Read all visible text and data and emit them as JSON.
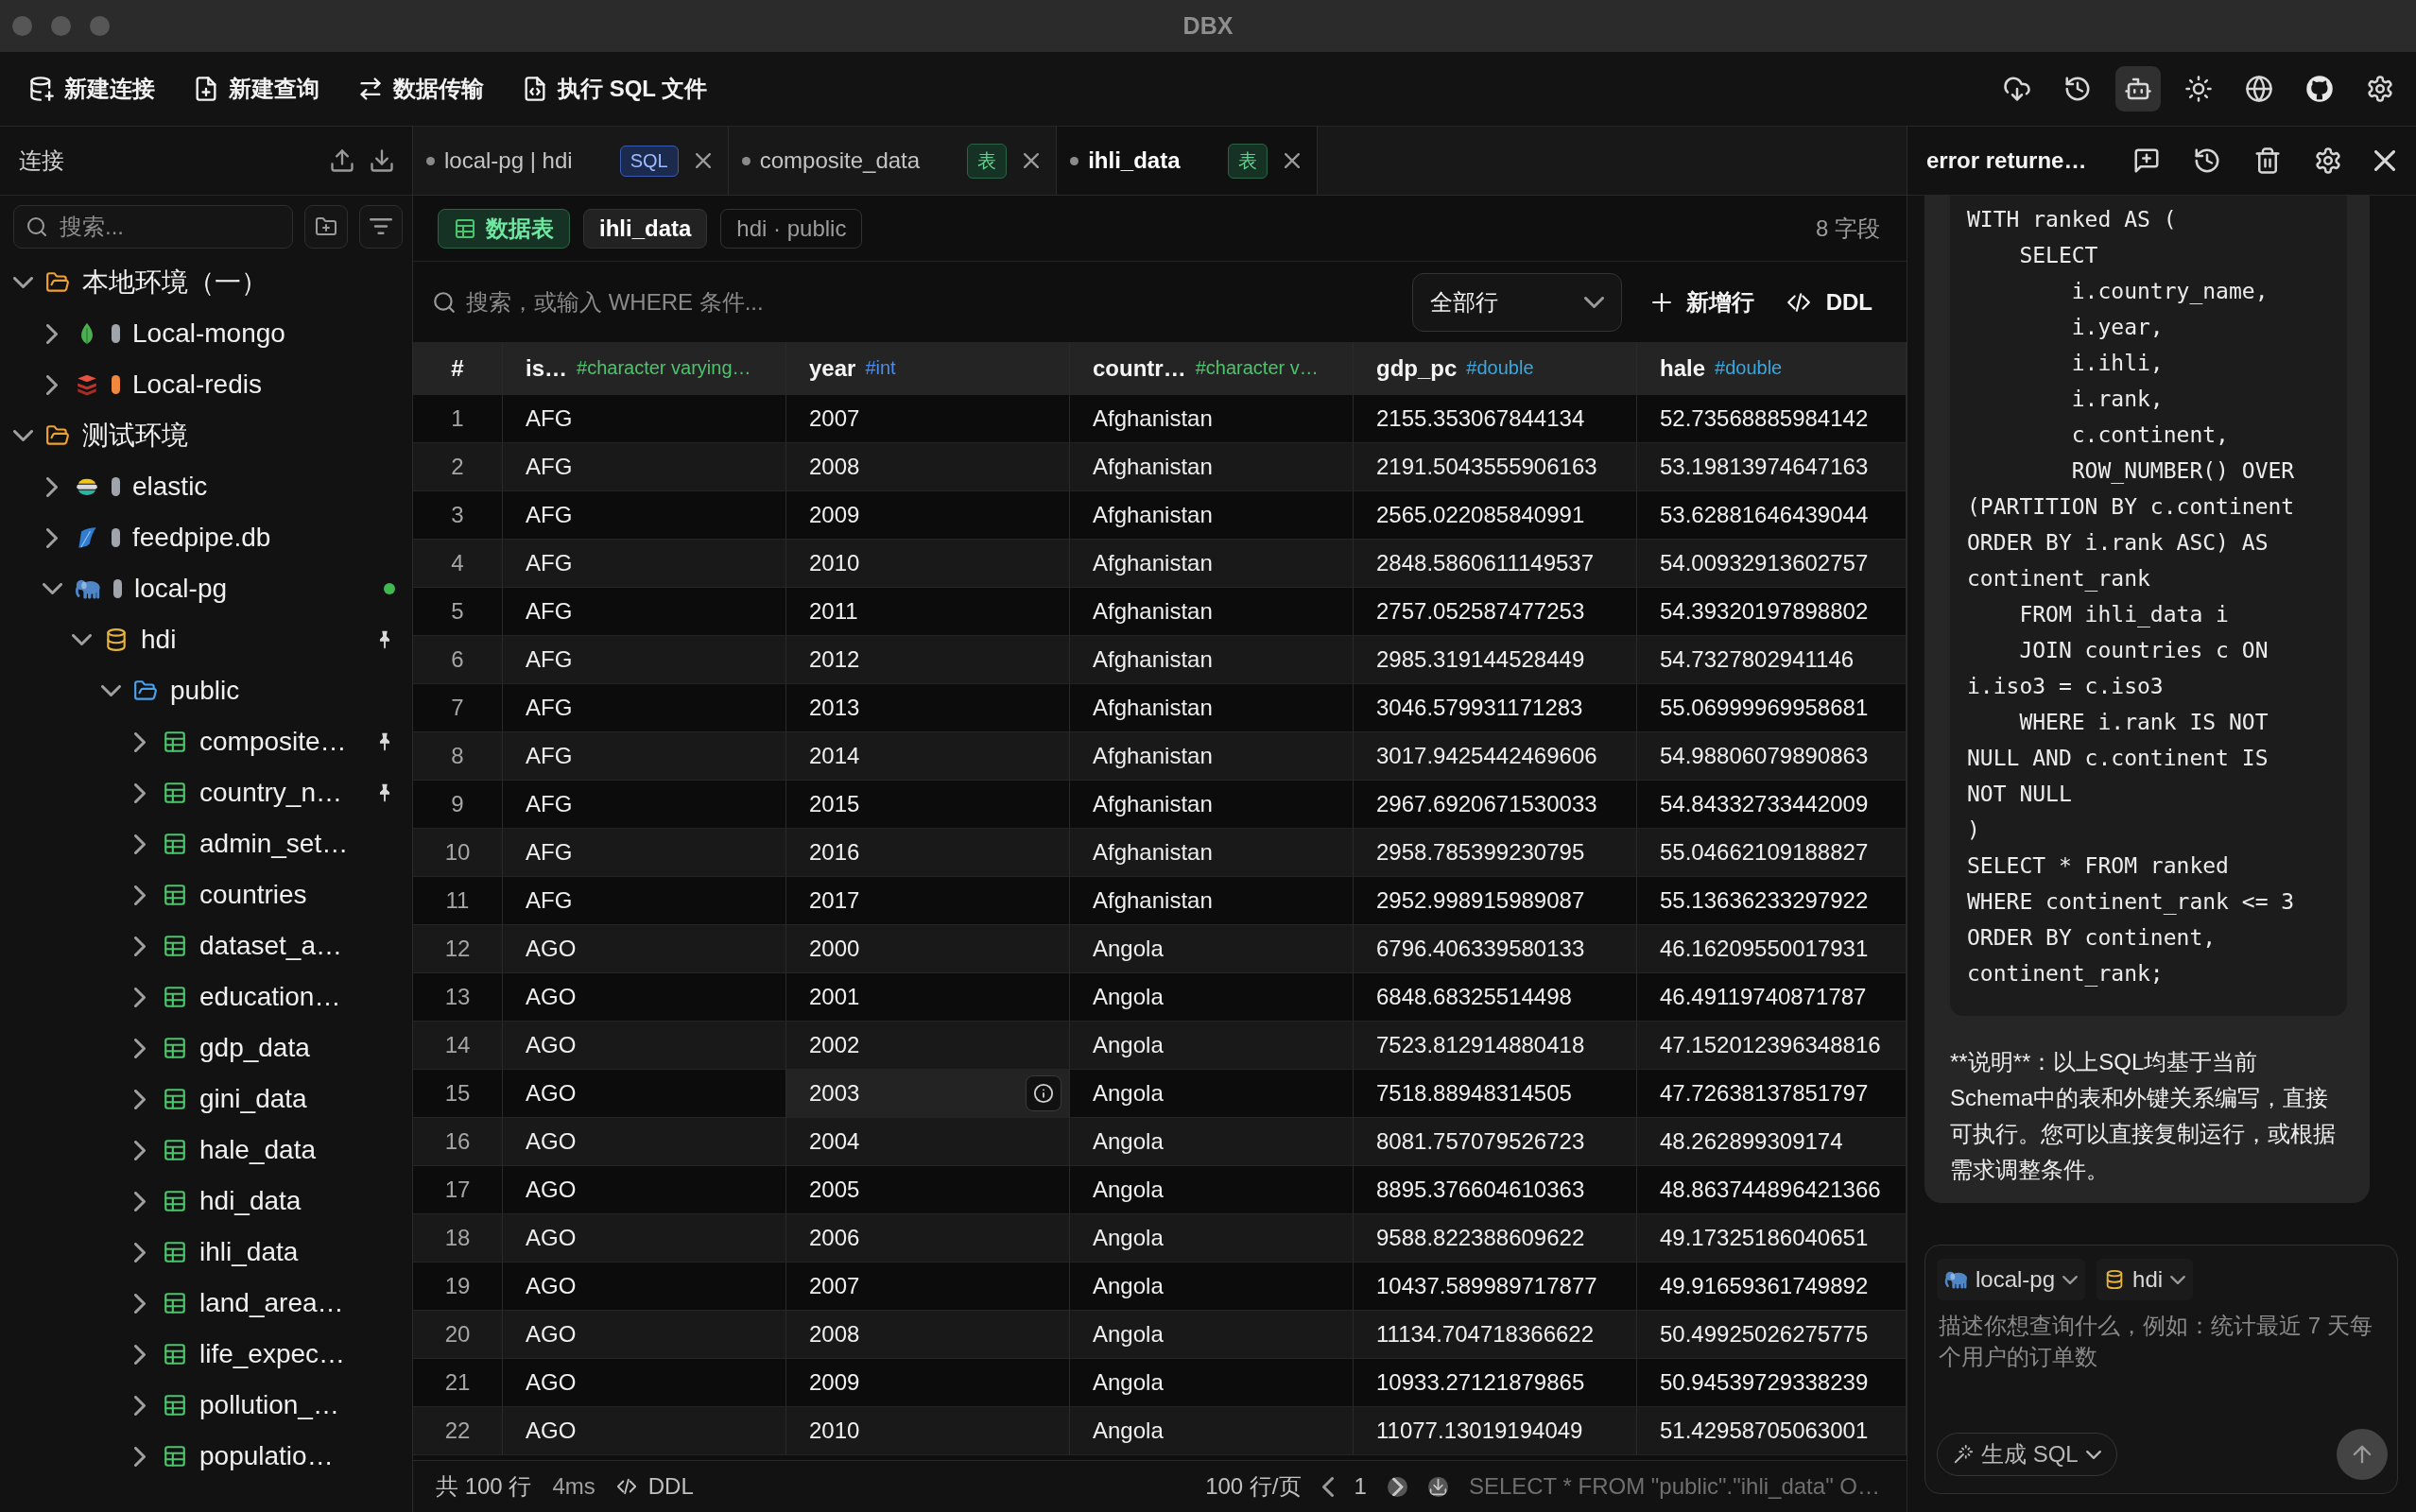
{
  "window": {
    "title": "DBX"
  },
  "toolbar": [
    {
      "label": "新建连接"
    },
    {
      "label": "新建查询"
    },
    {
      "label": "数据传输"
    },
    {
      "label": "执行 SQL 文件"
    }
  ],
  "toolbar_right": [
    {
      "selected": false
    },
    {
      "selected": false
    },
    {
      "selected": true
    },
    {
      "selected": false
    },
    {
      "selected": false
    },
    {
      "selected": false
    },
    {
      "selected": false
    }
  ],
  "sidebar": {
    "title": "连接",
    "search": {
      "placeholder": "搜索..."
    },
    "tree": [
      {
        "kind": "group",
        "label": "本地环境（一）",
        "expanded": true,
        "children": [
          {
            "kind": "mongodb",
            "label": "Local-mongo",
            "color": "#a0a4ab",
            "expanded": false,
            "connected": false
          },
          {
            "kind": "redis",
            "label": "Local-redis",
            "color": "#f0883e",
            "expanded": false,
            "connected": false
          }
        ]
      },
      {
        "kind": "group",
        "label": "测试环境",
        "expanded": true,
        "children": [
          {
            "kind": "elasticsearch",
            "label": "elastic",
            "color": "#a0a4ab",
            "expanded": false,
            "connected": false
          },
          {
            "kind": "sqlite",
            "label": "feedpipe.db",
            "color": "#a0a4ab",
            "expanded": false,
            "connected": false
          },
          {
            "kind": "postgresql",
            "label": "local-pg",
            "color": "#a0a4ab",
            "expanded": true,
            "connected": true,
            "children": [
              {
                "kind": "database",
                "label": "hdi",
                "expanded": true,
                "pinned": true,
                "children": [
                  {
                    "kind": "schema",
                    "label": "public",
                    "expanded": true,
                    "children": [
                      {
                        "kind": "table",
                        "label": "composite…",
                        "expanded": false,
                        "pinned": true
                      },
                      {
                        "kind": "table",
                        "label": "country_n…",
                        "expanded": false,
                        "pinned": true
                      },
                      {
                        "kind": "table",
                        "label": "admin_set…",
                        "expanded": false,
                        "pinned": false
                      },
                      {
                        "kind": "table",
                        "label": "countries",
                        "expanded": false,
                        "pinned": false
                      },
                      {
                        "kind": "table",
                        "label": "dataset_a…",
                        "expanded": false,
                        "pinned": false
                      },
                      {
                        "kind": "table",
                        "label": "education…",
                        "expanded": false,
                        "pinned": false
                      },
                      {
                        "kind": "table",
                        "label": "gdp_data",
                        "expanded": false,
                        "pinned": false
                      },
                      {
                        "kind": "table",
                        "label": "gini_data",
                        "expanded": false,
                        "pinned": false
                      },
                      {
                        "kind": "table",
                        "label": "hale_data",
                        "expanded": false,
                        "pinned": false
                      },
                      {
                        "kind": "table",
                        "label": "hdi_data",
                        "expanded": false,
                        "pinned": false
                      },
                      {
                        "kind": "table",
                        "label": "ihli_data",
                        "expanded": false,
                        "pinned": false
                      },
                      {
                        "kind": "table",
                        "label": "land_area…",
                        "expanded": false,
                        "pinned": false
                      },
                      {
                        "kind": "table",
                        "label": "life_expec…",
                        "expanded": false,
                        "pinned": false
                      },
                      {
                        "kind": "table",
                        "label": "pollution_…",
                        "expanded": false,
                        "pinned": false
                      },
                      {
                        "kind": "table",
                        "label": "populatio…",
                        "expanded": false,
                        "pinned": false
                      }
                    ]
                  }
                ]
              }
            ]
          }
        ]
      }
    ]
  },
  "tabs": [
    {
      "label": "local-pg | hdi",
      "badge": "SQL",
      "kind": "query",
      "selected": false
    },
    {
      "label": "composite_data",
      "badge": "表",
      "kind": "table",
      "selected": false
    },
    {
      "label": "ihli_data",
      "badge": "表",
      "kind": "table",
      "selected": true
    }
  ],
  "content": {
    "chips": [
      {
        "kind": "type",
        "label": "数据表"
      },
      {
        "kind": "name",
        "label": "ihli_data"
      },
      {
        "kind": "path",
        "label": "hdi · public"
      }
    ],
    "field_count": "8 字段",
    "filter": {
      "placeholder": "搜索，或输入 WHERE 条件..."
    },
    "row_filter": {
      "value": "全部行"
    },
    "actions": [
      {
        "label": "新增行"
      },
      {
        "label": "DDL"
      }
    ]
  },
  "table": {
    "columns": [
      {
        "name": "#"
      },
      {
        "name": "is…",
        "type": "#character varying…",
        "color": "#4cc46c"
      },
      {
        "name": "year",
        "type": "#int",
        "color": "#4a8cf0"
      },
      {
        "name": "countr…",
        "type": "#character v…",
        "color": "#4cc46c"
      },
      {
        "name": "gdp_pc",
        "type": "#double",
        "color": "#38a8e0"
      },
      {
        "name": "hale",
        "type": "#double",
        "color": "#38a8e0"
      }
    ],
    "rows": [
      {
        "cells": [
          "1",
          "AFG",
          "2007",
          "Afghanistan",
          "2155.353067844134",
          "52.73568885984142"
        ],
        "hovered": false
      },
      {
        "cells": [
          "2",
          "AFG",
          "2008",
          "Afghanistan",
          "2191.5043555906163",
          "53.19813974647163"
        ],
        "hovered": false
      },
      {
        "cells": [
          "3",
          "AFG",
          "2009",
          "Afghanistan",
          "2565.022085840991",
          "53.62881646439044"
        ],
        "hovered": false
      },
      {
        "cells": [
          "4",
          "AFG",
          "2010",
          "Afghanistan",
          "2848.5860611149537",
          "54.00932913602757"
        ],
        "hovered": false
      },
      {
        "cells": [
          "5",
          "AFG",
          "2011",
          "Afghanistan",
          "2757.052587477253",
          "54.39320197898802"
        ],
        "hovered": false
      },
      {
        "cells": [
          "6",
          "AFG",
          "2012",
          "Afghanistan",
          "2985.319144528449",
          "54.7327802941146"
        ],
        "hovered": false
      },
      {
        "cells": [
          "7",
          "AFG",
          "2013",
          "Afghanistan",
          "3046.579931171283",
          "55.06999969958681"
        ],
        "hovered": false
      },
      {
        "cells": [
          "8",
          "AFG",
          "2014",
          "Afghanistan",
          "3017.9425442469606",
          "54.98806079890863"
        ],
        "hovered": false
      },
      {
        "cells": [
          "9",
          "AFG",
          "2015",
          "Afghanistan",
          "2967.6920671530033",
          "54.84332733442009"
        ],
        "hovered": false
      },
      {
        "cells": [
          "10",
          "AFG",
          "2016",
          "Afghanistan",
          "2958.785399230795",
          "55.04662109188827"
        ],
        "hovered": false
      },
      {
        "cells": [
          "11",
          "AFG",
          "2017",
          "Afghanistan",
          "2952.998915989087",
          "55.13636233297922"
        ],
        "hovered": false
      },
      {
        "cells": [
          "12",
          "AGO",
          "2000",
          "Angola",
          "6796.406339580133",
          "46.16209550017931"
        ],
        "hovered": false
      },
      {
        "cells": [
          "13",
          "AGO",
          "2001",
          "Angola",
          "6848.68325514498",
          "46.49119740871787"
        ],
        "hovered": false
      },
      {
        "cells": [
          "14",
          "AGO",
          "2002",
          "Angola",
          "7523.812914880418",
          "47.152012396348816"
        ],
        "hovered": false
      },
      {
        "cells": [
          "15",
          "AGO",
          "2003",
          "Angola",
          "7518.88948314505",
          "47.72638137851797"
        ],
        "hovered": true
      },
      {
        "cells": [
          "16",
          "AGO",
          "2004",
          "Angola",
          "8081.757079526723",
          "48.262899309174"
        ],
        "hovered": false
      },
      {
        "cells": [
          "17",
          "AGO",
          "2005",
          "Angola",
          "8895.376604610363",
          "48.863744896421366"
        ],
        "hovered": false
      },
      {
        "cells": [
          "18",
          "AGO",
          "2006",
          "Angola",
          "9588.822388609622",
          "49.17325186040651"
        ],
        "hovered": false
      },
      {
        "cells": [
          "19",
          "AGO",
          "2007",
          "Angola",
          "10437.589989717877",
          "49.91659361749892"
        ],
        "hovered": false
      },
      {
        "cells": [
          "20",
          "AGO",
          "2008",
          "Angola",
          "11134.704718366622",
          "50.49925026275775"
        ],
        "hovered": false
      },
      {
        "cells": [
          "21",
          "AGO",
          "2009",
          "Angola",
          "10933.27121879865",
          "50.94539729338239"
        ],
        "hovered": false
      },
      {
        "cells": [
          "22",
          "AGO",
          "2010",
          "Angola",
          "11077.13019194049",
          "51.42958705063001"
        ],
        "hovered": false
      }
    ]
  },
  "footer": {
    "total": "共 100 行",
    "time": "4ms",
    "ddl": "DDL",
    "page_size": "100 行/页",
    "page": "1",
    "sql": "SELECT * FROM \"public\".\"ihli_data\" O…"
  },
  "assistant": {
    "title": "error returne…",
    "code_lines": [
      "WITH ranked AS (",
      "    SELECT",
      "        i.country_name,",
      "        i.year,",
      "        i.ihli,",
      "        i.rank,",
      "        c.continent,",
      "        ROW_NUMBER() OVER",
      "(PARTITION BY c.continent",
      "ORDER BY i.rank ASC) AS",
      "continent_rank",
      "    FROM ihli_data i",
      "    JOIN countries c ON",
      "i.iso3 = c.iso3",
      "    WHERE i.rank IS NOT",
      "NULL AND c.continent IS",
      "NOT NULL",
      ")",
      "SELECT * FROM ranked",
      "WHERE continent_rank <= 3",
      "ORDER BY continent,",
      "continent_rank;"
    ],
    "note": "**说明**：以上SQL均基于当前Schema中的表和外键关系编写，直接可执行。您可以直接复制运行，或根据需求调整条件。",
    "input": {
      "connection": "local-pg",
      "database": "hdi",
      "placeholder": "描述你想查询什么，例如：统计最近 7 天每个用户的订单数",
      "generate": "生成 SQL"
    }
  }
}
